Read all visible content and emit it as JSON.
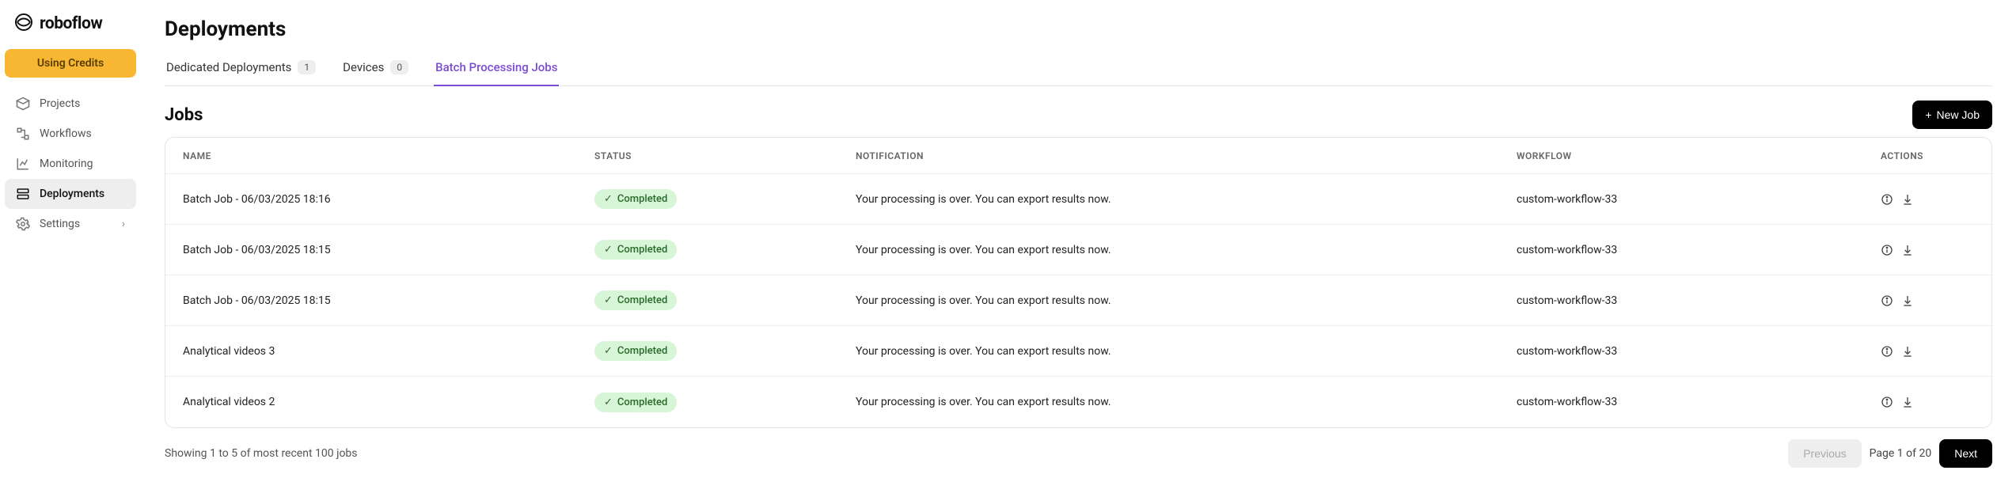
{
  "brand": "roboflow",
  "sidebar": {
    "credits_label": "Using Credits",
    "items": [
      {
        "label": "Projects"
      },
      {
        "label": "Workflows"
      },
      {
        "label": "Monitoring"
      },
      {
        "label": "Deployments"
      },
      {
        "label": "Settings"
      }
    ]
  },
  "page": {
    "title": "Deployments"
  },
  "tabs": [
    {
      "label": "Dedicated Deployments",
      "count": "1"
    },
    {
      "label": "Devices",
      "count": "0"
    },
    {
      "label": "Batch Processing Jobs"
    }
  ],
  "section": {
    "title": "Jobs",
    "new_job_label": "New Job"
  },
  "table": {
    "headers": {
      "name": "NAME",
      "status": "STATUS",
      "notification": "NOTIFICATION",
      "workflow": "WORKFLOW",
      "actions": "ACTIONS"
    },
    "rows": [
      {
        "name": "Batch Job - 06/03/2025 18:16",
        "status": "Completed",
        "notification": "Your processing is over. You can export results now.",
        "workflow": "custom-workflow-33"
      },
      {
        "name": "Batch Job - 06/03/2025 18:15",
        "status": "Completed",
        "notification": "Your processing is over. You can export results now.",
        "workflow": "custom-workflow-33"
      },
      {
        "name": "Batch Job - 06/03/2025 18:15",
        "status": "Completed",
        "notification": "Your processing is over. You can export results now.",
        "workflow": "custom-workflow-33"
      },
      {
        "name": "Analytical videos 3",
        "status": "Completed",
        "notification": "Your processing is over. You can export results now.",
        "workflow": "custom-workflow-33"
      },
      {
        "name": "Analytical videos 2",
        "status": "Completed",
        "notification": "Your processing is over. You can export results now.",
        "workflow": "custom-workflow-33"
      }
    ]
  },
  "footer": {
    "summary": "Showing 1 to 5 of most recent 100 jobs",
    "prev": "Previous",
    "page": "Page 1 of 20",
    "next": "Next"
  }
}
